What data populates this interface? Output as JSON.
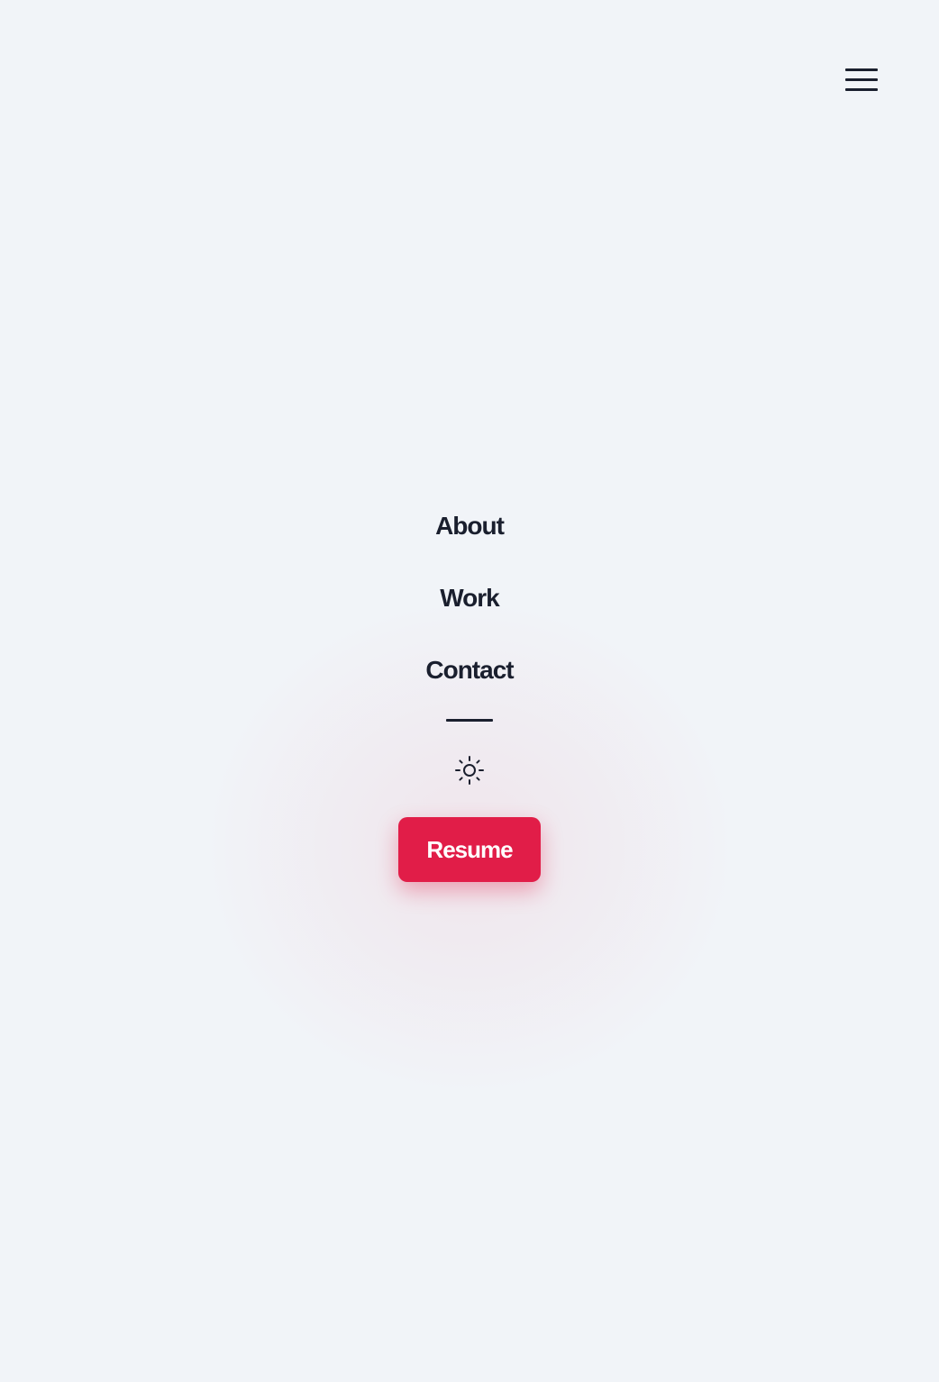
{
  "header": {
    "menu_icon": "hamburger-menu-icon"
  },
  "nav": {
    "items": [
      {
        "label": "About"
      },
      {
        "label": "Work"
      },
      {
        "label": "Contact"
      }
    ],
    "theme_icon": "sun-icon",
    "resume_label": "Resume"
  },
  "colors": {
    "background": "#f1f4f8",
    "text": "#1a1f2e",
    "accent": "#e11d48"
  }
}
